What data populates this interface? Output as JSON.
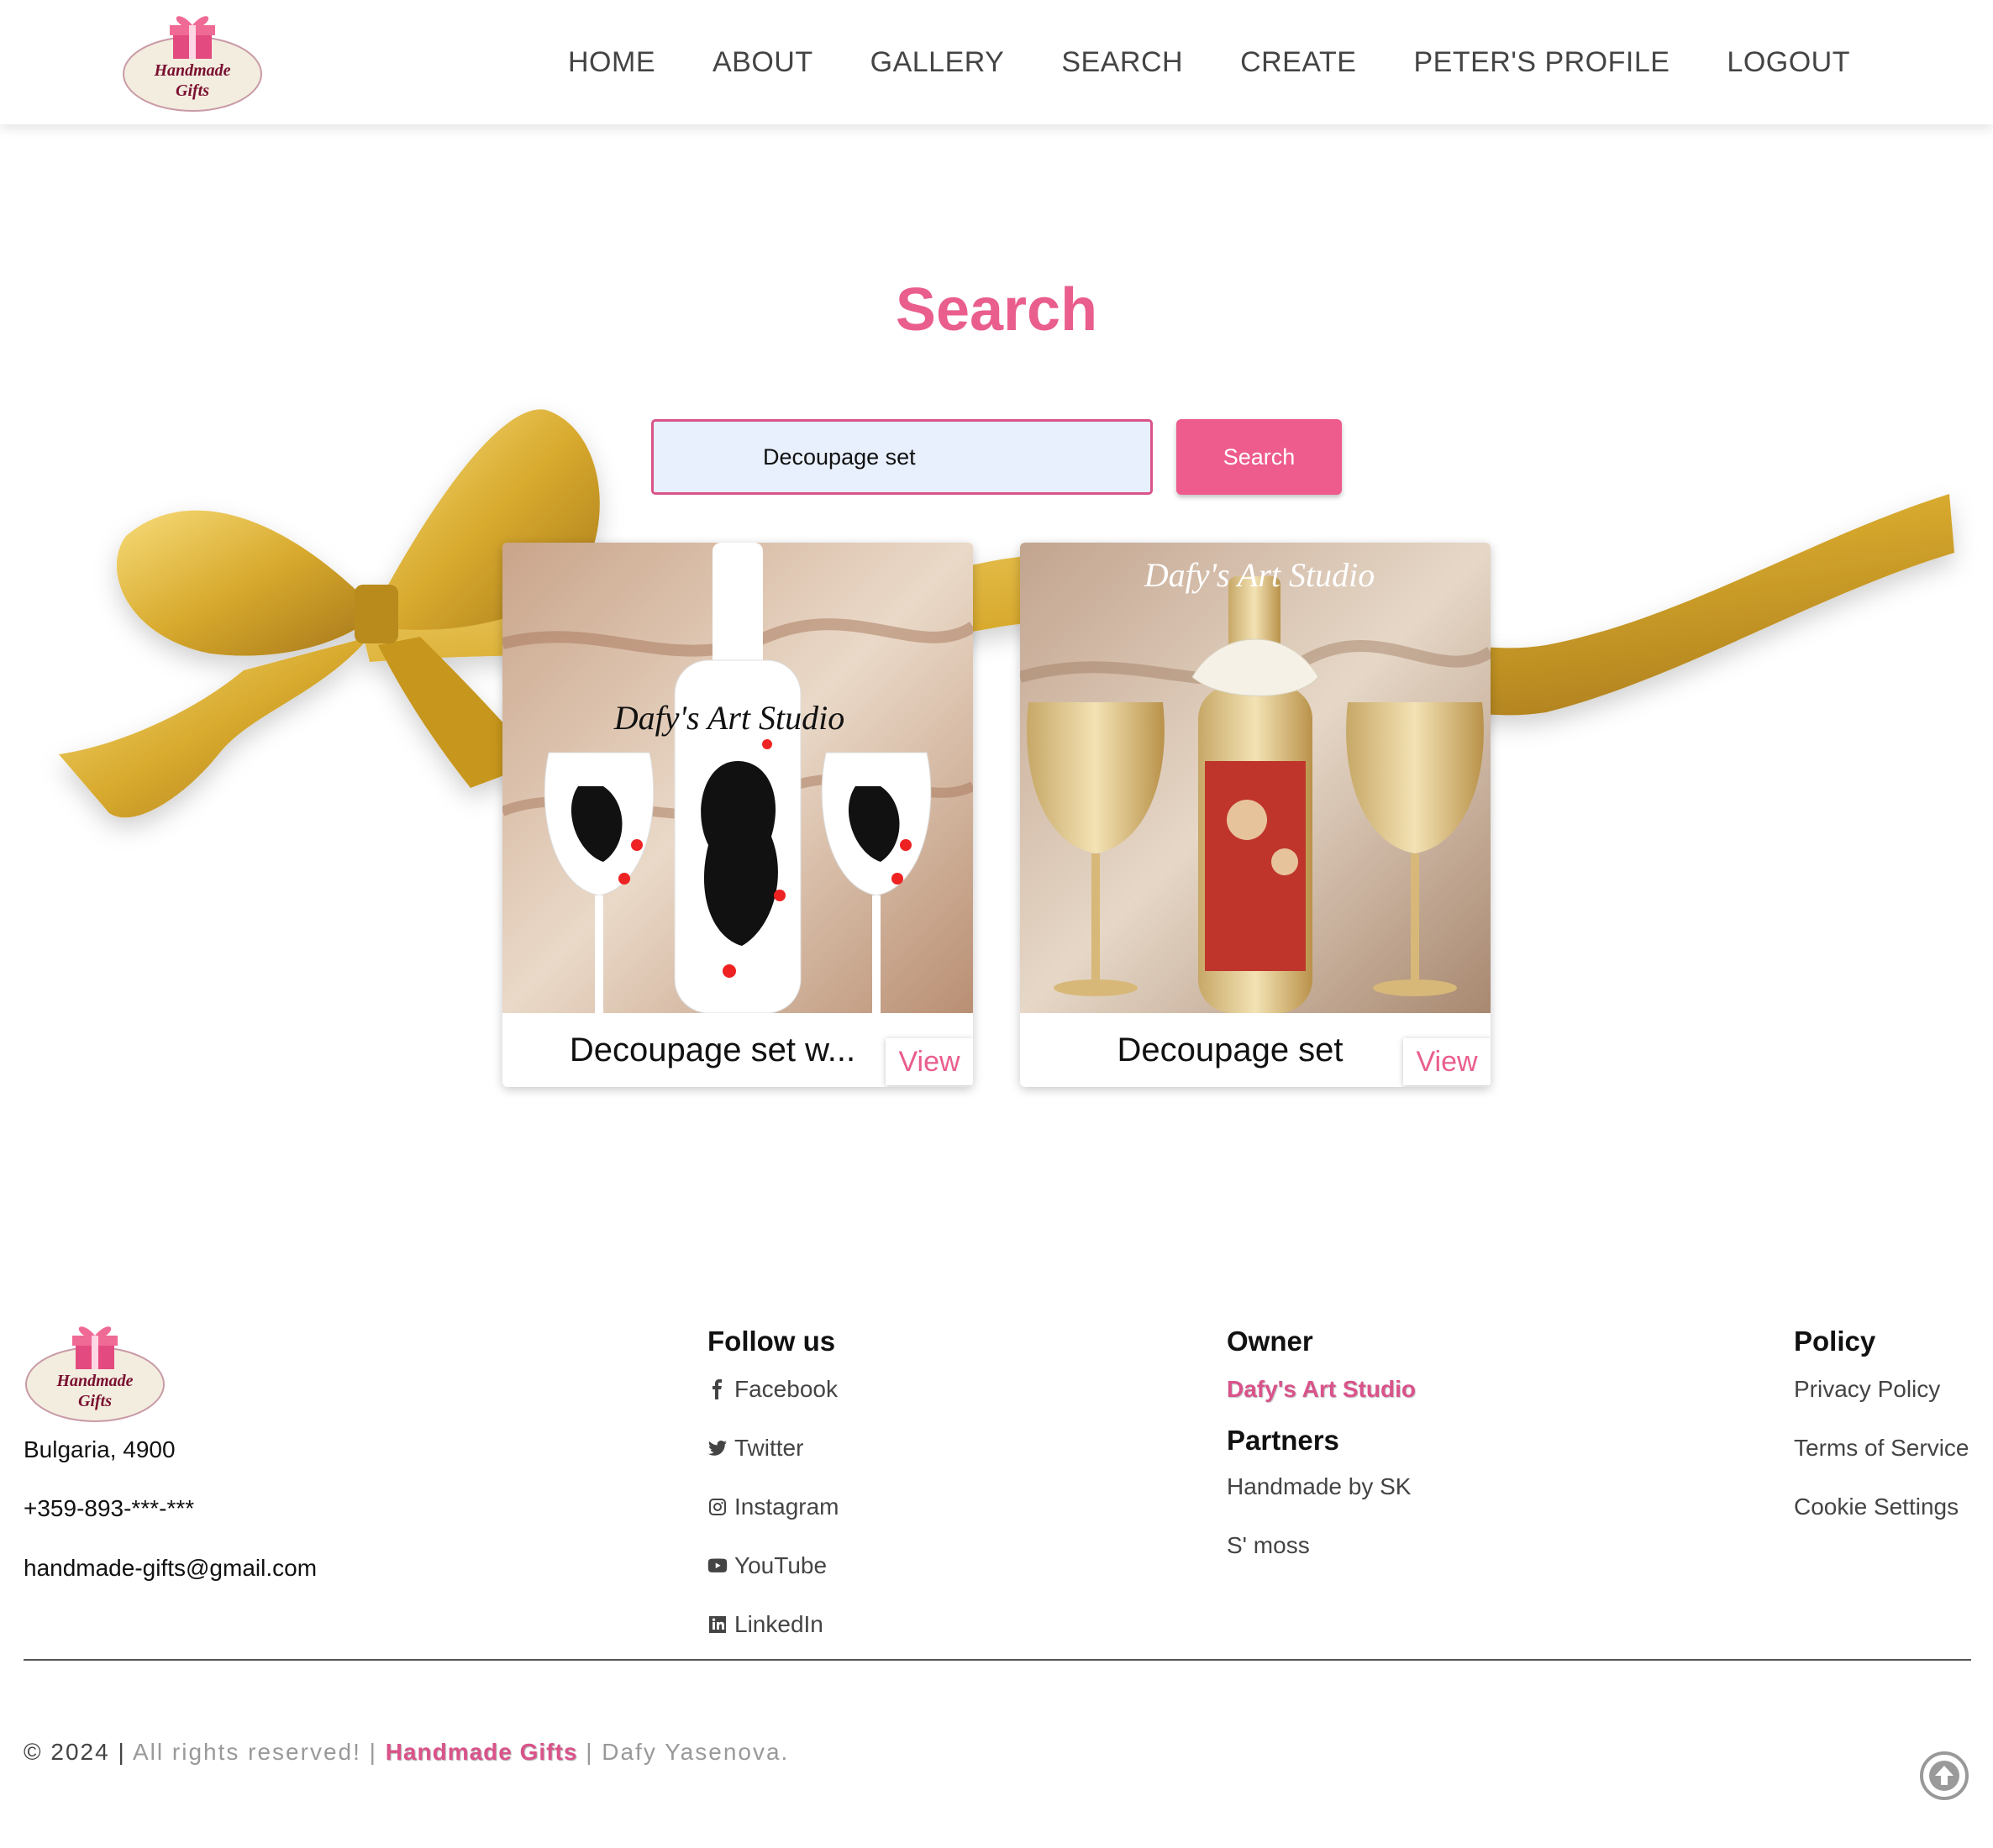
{
  "brand": {
    "logo_line1": "Handmade",
    "logo_line2": "Gifts"
  },
  "nav": {
    "items": [
      {
        "label": "HOME"
      },
      {
        "label": "ABOUT"
      },
      {
        "label": "GALLERY"
      },
      {
        "label": "SEARCH"
      },
      {
        "label": "CREATE"
      },
      {
        "label": "PETER'S PROFILE"
      },
      {
        "label": "LOGOUT"
      }
    ]
  },
  "main": {
    "title": "Search",
    "search": {
      "value": "Decoupage set",
      "button_label": "Search"
    },
    "cards": [
      {
        "title": "Decoupage set w...",
        "view_label": "View",
        "watermark": "Dafy's Art Studio"
      },
      {
        "title": "Decoupage set",
        "view_label": "View",
        "watermark": "Dafy's Art Studio"
      }
    ]
  },
  "footer": {
    "address": "Bulgaria, 4900",
    "phone": "+359-893-***-***",
    "email": "handmade-gifts@gmail.com",
    "follow": {
      "heading": "Follow us",
      "links": [
        {
          "label": "Facebook",
          "icon": "facebook-icon"
        },
        {
          "label": "Twitter",
          "icon": "twitter-icon"
        },
        {
          "label": "Instagram",
          "icon": "instagram-icon"
        },
        {
          "label": "YouTube",
          "icon": "youtube-icon"
        },
        {
          "label": "LinkedIn",
          "icon": "linkedin-icon"
        }
      ]
    },
    "owner": {
      "heading": "Owner",
      "name": "Dafy's Art Studio"
    },
    "partners": {
      "heading": "Partners",
      "items": [
        "Handmade by SK",
        "S' moss"
      ]
    },
    "policy": {
      "heading": "Policy",
      "items": [
        "Privacy Policy",
        "Terms of Service",
        "Cookie Settings"
      ]
    },
    "copyright": {
      "year": "© 2024",
      "sep1": "|",
      "rights": "All rights reserved! |",
      "brand": "Handmade Gifts",
      "author": "| Dafy Yasenova."
    }
  },
  "colors": {
    "accent": "#ee5b8d",
    "accent_dark": "#d9538a",
    "input_bg": "#e8f0fe",
    "ribbon": "#d8aa2e"
  }
}
